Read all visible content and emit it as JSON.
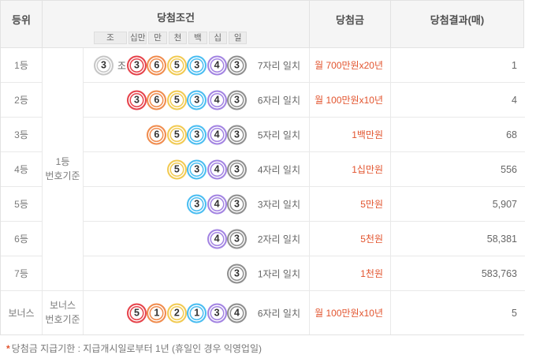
{
  "header": {
    "rank": "등위",
    "condition": "당첨조건",
    "prize": "당첨금",
    "result": "당첨결과(매)",
    "position_labels": [
      "조",
      "십만",
      "만",
      "천",
      "백",
      "십",
      "일"
    ]
  },
  "basis": {
    "first": [
      "1등",
      "번호기준"
    ],
    "bonus": [
      "보너스",
      "번호기준"
    ]
  },
  "group_suffix": "조",
  "winning_numbers": {
    "group": "3",
    "digits": [
      "3",
      "6",
      "5",
      "3",
      "4",
      "3"
    ],
    "bonus_digits": [
      "5",
      "1",
      "2",
      "1",
      "3",
      "4"
    ]
  },
  "ball_colors": {
    "group": "#c6c6c6",
    "positions": [
      "#e6434b",
      "#f08c4e",
      "#f2ca52",
      "#4abdf1",
      "#a384e2",
      "#8f8f8f"
    ]
  },
  "colors": {
    "prize_text": "#e2532d",
    "header_bg": "#f5f5f5"
  },
  "rows": [
    {
      "rank": "1등",
      "show_group": true,
      "bonus": false,
      "digit_start": 0,
      "match": "7자리 일치",
      "prize": "월 700만원x20년",
      "count": "1"
    },
    {
      "rank": "2등",
      "show_group": false,
      "bonus": false,
      "digit_start": 0,
      "match": "6자리 일치",
      "prize": "월 100만원x10년",
      "count": "4"
    },
    {
      "rank": "3등",
      "show_group": false,
      "bonus": false,
      "digit_start": 1,
      "match": "5자리 일치",
      "prize": "1백만원",
      "count": "68"
    },
    {
      "rank": "4등",
      "show_group": false,
      "bonus": false,
      "digit_start": 2,
      "match": "4자리 일치",
      "prize": "1십만원",
      "count": "556"
    },
    {
      "rank": "5등",
      "show_group": false,
      "bonus": false,
      "digit_start": 3,
      "match": "3자리 일치",
      "prize": "5만원",
      "count": "5,907"
    },
    {
      "rank": "6등",
      "show_group": false,
      "bonus": false,
      "digit_start": 4,
      "match": "2자리 일치",
      "prize": "5천원",
      "count": "58,381"
    },
    {
      "rank": "7등",
      "show_group": false,
      "bonus": false,
      "digit_start": 5,
      "match": "1자리 일치",
      "prize": "1천원",
      "count": "583,763"
    },
    {
      "rank": "보너스",
      "show_group": false,
      "bonus": true,
      "digit_start": 0,
      "match": "6자리 일치",
      "prize": "월 100만원x10년",
      "count": "5"
    }
  ],
  "footnote": {
    "marker": "*",
    "text": "당첨금 지급기한 : 지급개시일로부터 1년 (휴일인 경우 익영업일)"
  }
}
